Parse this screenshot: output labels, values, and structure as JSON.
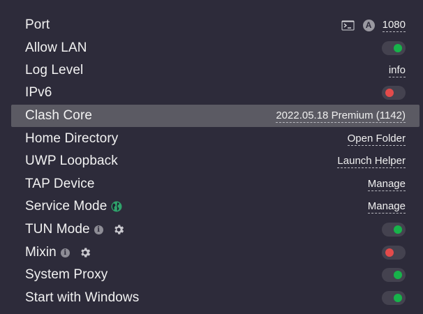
{
  "settings": {
    "port": {
      "label": "Port",
      "value": "1080",
      "badge": "A"
    },
    "allow_lan": {
      "label": "Allow LAN",
      "state": "on"
    },
    "log_level": {
      "label": "Log Level",
      "value": "info"
    },
    "ipv6": {
      "label": "IPv6",
      "state": "off"
    },
    "clash_core": {
      "label": "Clash Core",
      "value": "2022.05.18 Premium (1142)"
    },
    "home_directory": {
      "label": "Home Directory",
      "action": "Open Folder"
    },
    "uwp_loopback": {
      "label": "UWP Loopback",
      "action": "Launch Helper"
    },
    "tap_device": {
      "label": "TAP Device",
      "action": "Manage"
    },
    "service_mode": {
      "label": "Service Mode",
      "action": "Manage"
    },
    "tun_mode": {
      "label": "TUN Mode",
      "state": "on"
    },
    "mixin": {
      "label": "Mixin",
      "state": "off"
    },
    "system_proxy": {
      "label": "System Proxy",
      "state": "on"
    },
    "start_with_windows": {
      "label": "Start with Windows",
      "state": "on"
    }
  },
  "colors": {
    "background": "#2d2b3a",
    "highlight": "#5b5a63",
    "toggle_on": "#17b34a",
    "toggle_off": "#e34b4b",
    "globe": "#2fa36b"
  },
  "icons": {
    "terminal": "terminal-icon",
    "badge": "a-badge-icon",
    "info": "info-icon",
    "gear": "gear-icon",
    "globe": "globe-icon"
  }
}
